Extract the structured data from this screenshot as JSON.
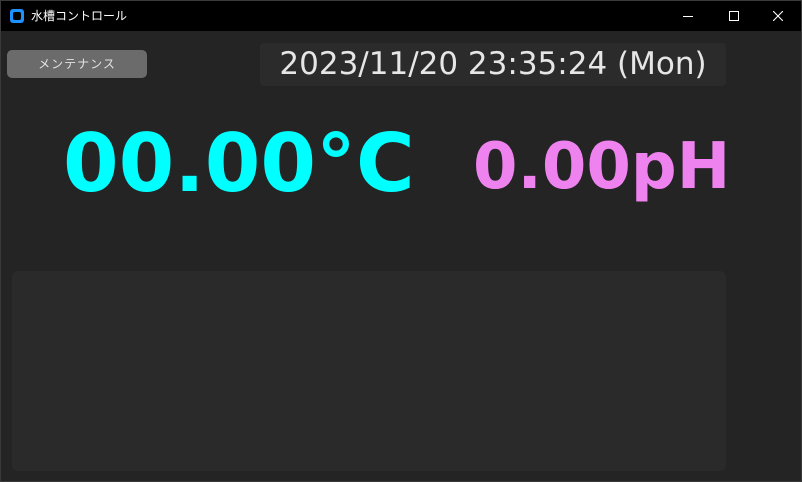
{
  "window": {
    "title": "水槽コントロール",
    "controls": {
      "minimize_icon": "minimize-icon",
      "maximize_icon": "maximize-icon",
      "close_icon": "close-icon"
    }
  },
  "toolbar": {
    "maintenance_label": "メンテナンス"
  },
  "clock": {
    "datetime": "2023/11/20 23:35:24 (Mon)"
  },
  "readings": {
    "temperature": "00.00°C",
    "ph": "0.00pH"
  },
  "colors": {
    "temperature": "#00ffff",
    "ph": "#ee82ee",
    "accent_icon": "#1e90ff"
  }
}
